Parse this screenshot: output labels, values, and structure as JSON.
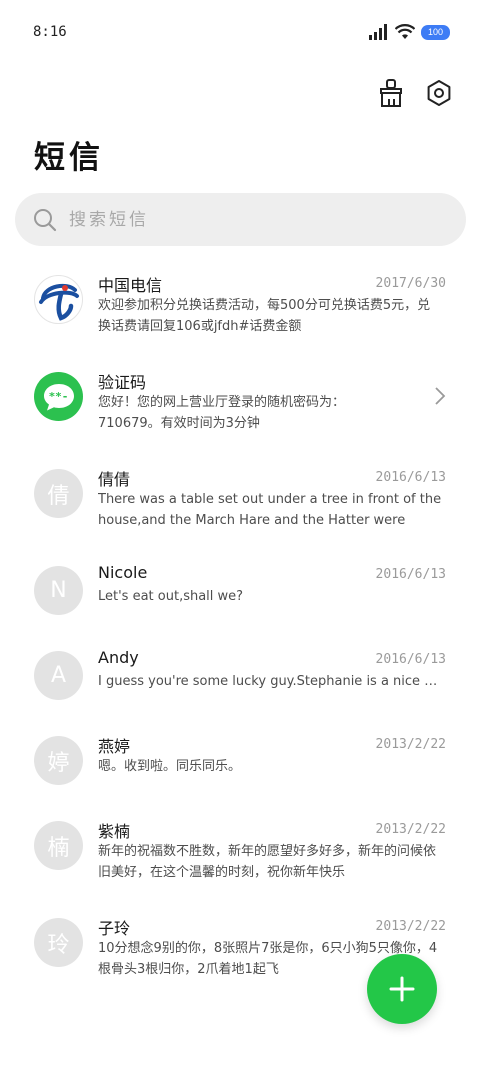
{
  "status_bar": {
    "time": "8:16",
    "battery": "100",
    "icons": [
      "signal-icon",
      "wifi-icon",
      "battery-icon"
    ]
  },
  "header": {
    "title": "短信",
    "actions": [
      "broom-icon",
      "settings-icon"
    ]
  },
  "search": {
    "placeholder": "搜索短信"
  },
  "colors": {
    "accent": "#23c748",
    "avatar_gray": "#e3e3e3",
    "battery": "#3d7cf5"
  },
  "conversations": [
    {
      "name": "中国电信",
      "date": "2017/6/30",
      "avatar_type": "telecom-logo",
      "avatar_text": "",
      "preview": "欢迎参加积分兑换话费活动，每500分可兑换话费5元，兑换话费请回复106或jfdh#话费金额"
    },
    {
      "name": "验证码",
      "date": "",
      "avatar_type": "message-icon",
      "avatar_text": "**-",
      "preview": "您好！您的网上营业厅登录的随机密码为：710679。有效时间为3分钟"
    },
    {
      "name": "倩倩",
      "date": "2016/6/13",
      "avatar_type": "initial",
      "avatar_text": "倩",
      "preview": "There was a table set out under a tree in front of the house,and the March Hare and the Hatter were having tea at it"
    },
    {
      "name": "Nicole",
      "date": "2016/6/13",
      "avatar_type": "initial",
      "avatar_text": "N",
      "preview": "Let's eat out,shall we?"
    },
    {
      "name": "Andy",
      "date": "2016/6/13",
      "avatar_type": "initial",
      "avatar_text": "A",
      "preview": "I guess you're some lucky guy.Stephanie is a nice girl."
    },
    {
      "name": "燕婷",
      "date": "2013/2/22",
      "avatar_type": "initial",
      "avatar_text": "婷",
      "preview": "嗯。收到啦。同乐同乐。"
    },
    {
      "name": "紫楠",
      "date": "2013/2/22",
      "avatar_type": "initial",
      "avatar_text": "楠",
      "preview": "新年的祝福数不胜数，新年的愿望好多好多，新年的问候依旧美好，在这个温馨的时刻，祝你新年快乐"
    },
    {
      "name": "子玲",
      "date": "2013/2/22",
      "avatar_type": "initial",
      "avatar_text": "玲",
      "preview": "10分想念9别的你，8张照片7张是你，6只小狗5只像你，4根骨头3根归你，2爪着地1起飞"
    }
  ],
  "fab": {
    "icon": "plus-icon"
  }
}
